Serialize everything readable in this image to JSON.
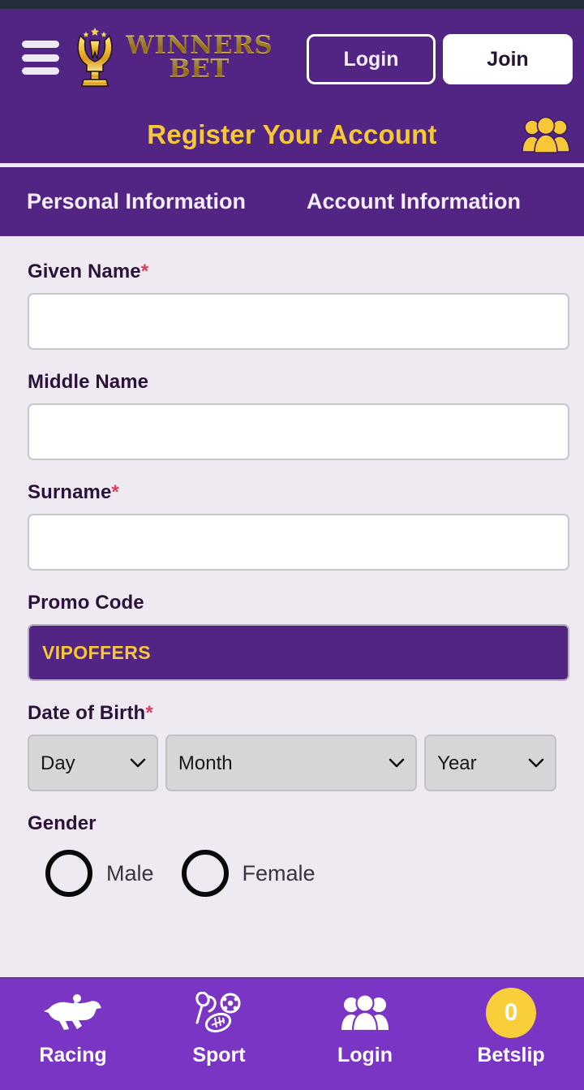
{
  "header": {
    "menu_icon": "hamburger-menu-icon",
    "logo": {
      "icon": "trophy-icon",
      "line1": "WINNERS",
      "line2": "BET"
    },
    "login_label": "Login",
    "join_label": "Join",
    "page_title": "Register Your Account",
    "title_icon": "people-group-icon",
    "colors": {
      "purple": "#522484",
      "gold": "#f6c838",
      "gold_divider": "#e3ab3a",
      "status_bar": "#232f3a"
    }
  },
  "tabs": [
    {
      "label": "Personal Information",
      "active": true
    },
    {
      "label": "Account Information",
      "active": false
    }
  ],
  "form": {
    "fields": [
      {
        "label": "Given Name",
        "required": true,
        "value": "",
        "placeholder": ""
      },
      {
        "label": "Middle Name",
        "required": false,
        "value": "",
        "placeholder": ""
      },
      {
        "label": "Surname",
        "required": true,
        "value": "",
        "placeholder": ""
      }
    ],
    "promo": {
      "label": "Promo Code",
      "required": false,
      "value": "VIPOFFERS",
      "placeholder": "",
      "text_color": "#f6c838",
      "background": "#522484"
    },
    "dob": {
      "label": "Date of Birth",
      "required": true,
      "day": "Day",
      "month": "Month",
      "year": "Year",
      "chevron_icon": "chevron-down-icon"
    },
    "gender": {
      "label": "Gender",
      "options": [
        {
          "label": "Male",
          "selected": false
        },
        {
          "label": "Female",
          "selected": false
        }
      ]
    }
  },
  "bottom_nav": [
    {
      "label": "Racing",
      "icon": "horse-racing-icon"
    },
    {
      "label": "Sport",
      "icon": "sports-balls-icon"
    },
    {
      "label": "Login",
      "icon": "people-group-icon"
    },
    {
      "label": "Betslip",
      "icon": "betslip-count-badge",
      "count": "0"
    }
  ]
}
